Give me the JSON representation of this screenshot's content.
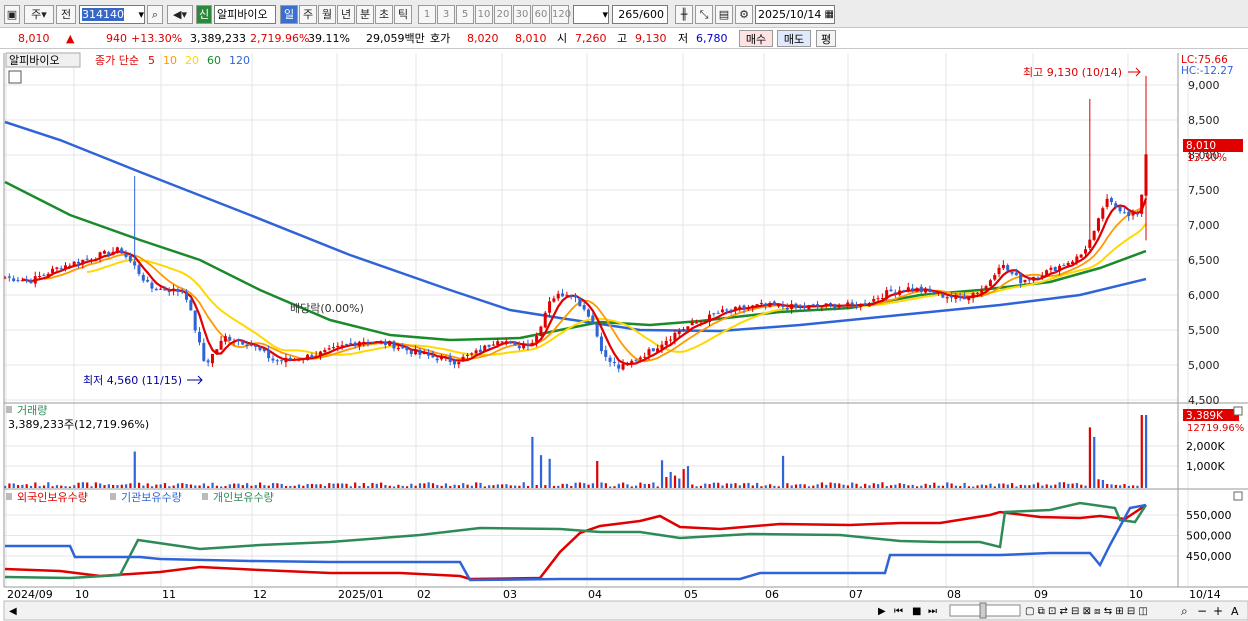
{
  "toolbar": {
    "market": "주",
    "prev": "전",
    "code": "314140",
    "stock_name": "알피바이오",
    "new_badge": "신",
    "periods": [
      "일",
      "주",
      "월",
      "년",
      "분",
      "초",
      "틱"
    ],
    "intervals": [
      "1",
      "3",
      "5",
      "10",
      "20",
      "30",
      "60",
      "120"
    ],
    "count": "265",
    "count_max": "/600",
    "date": "2025/10/14",
    "icons": [
      "window-icon",
      "search-icon",
      "speaker-icon",
      "candle-tool-icon",
      "draw-tool-icon",
      "save-icon",
      "settings-icon",
      "calendar-icon"
    ]
  },
  "infobar": {
    "price": "8,010",
    "arrow": "▲",
    "change": "940",
    "change_pct": "+13.30%",
    "volume": "3,389,233",
    "volume_pct": "2,719.96%",
    "turnover": "39.11%",
    "amount": "29,059백만",
    "bid_label": "호가",
    "ask": "8,020",
    "bid": "8,010",
    "open_label": "시",
    "open": "7,260",
    "high_label": "고",
    "high": "9,130",
    "low_label": "저",
    "low": "6,780",
    "buy_btn": "매수",
    "sell_btn": "매도",
    "eval_btn": "평"
  },
  "price_panel": {
    "tab": "알피바이오",
    "ma_title": "종가 단순",
    "ma": [
      {
        "p": "5",
        "color": "#e00000"
      },
      {
        "p": "10",
        "color": "#ff9900"
      },
      {
        "p": "20",
        "color": "#ffd800"
      },
      {
        "p": "60",
        "color": "#1a8a2a"
      },
      {
        "p": "120",
        "color": "#2f64d8"
      }
    ],
    "lc": "LC:75.66",
    "hc": "HC:-12.27",
    "max_label": "최고 9,130 (10/14)",
    "min_label": "최저 4,560 (11/15)",
    "dividend_label": "배당락(0.00%)",
    "last_price": "8,010",
    "last_pct": "13.30%",
    "y_ticks": [
      "9,000",
      "8,500",
      "8,000",
      "7,500",
      "7,000",
      "6,500",
      "6,000",
      "5,500",
      "5,000",
      "4,500"
    ]
  },
  "volume_panel": {
    "title": "거래량",
    "current": "3,389,233주(12,719.96%)",
    "last_box": "3,389K",
    "last_pct": "12719.96%",
    "y_ticks": [
      "2,000K",
      "1,000K"
    ]
  },
  "holding_panel": {
    "legend": [
      {
        "name": "외국인보유수량",
        "color": "#e00000"
      },
      {
        "name": "기관보유수량",
        "color": "#2f64d8"
      },
      {
        "name": "개인보유수량",
        "color": "#2e8b57"
      }
    ],
    "y_ticks": [
      "550,000",
      "500,000",
      "450,000"
    ]
  },
  "x_axis": [
    "2024/09",
    "10",
    "11",
    "12",
    "2025/01",
    "02",
    "03",
    "04",
    "05",
    "06",
    "07",
    "08",
    "09",
    "10",
    "10/14"
  ],
  "colors": {
    "up": "#e00000",
    "down": "#2f64d8",
    "grid": "#e6e6e6"
  }
}
